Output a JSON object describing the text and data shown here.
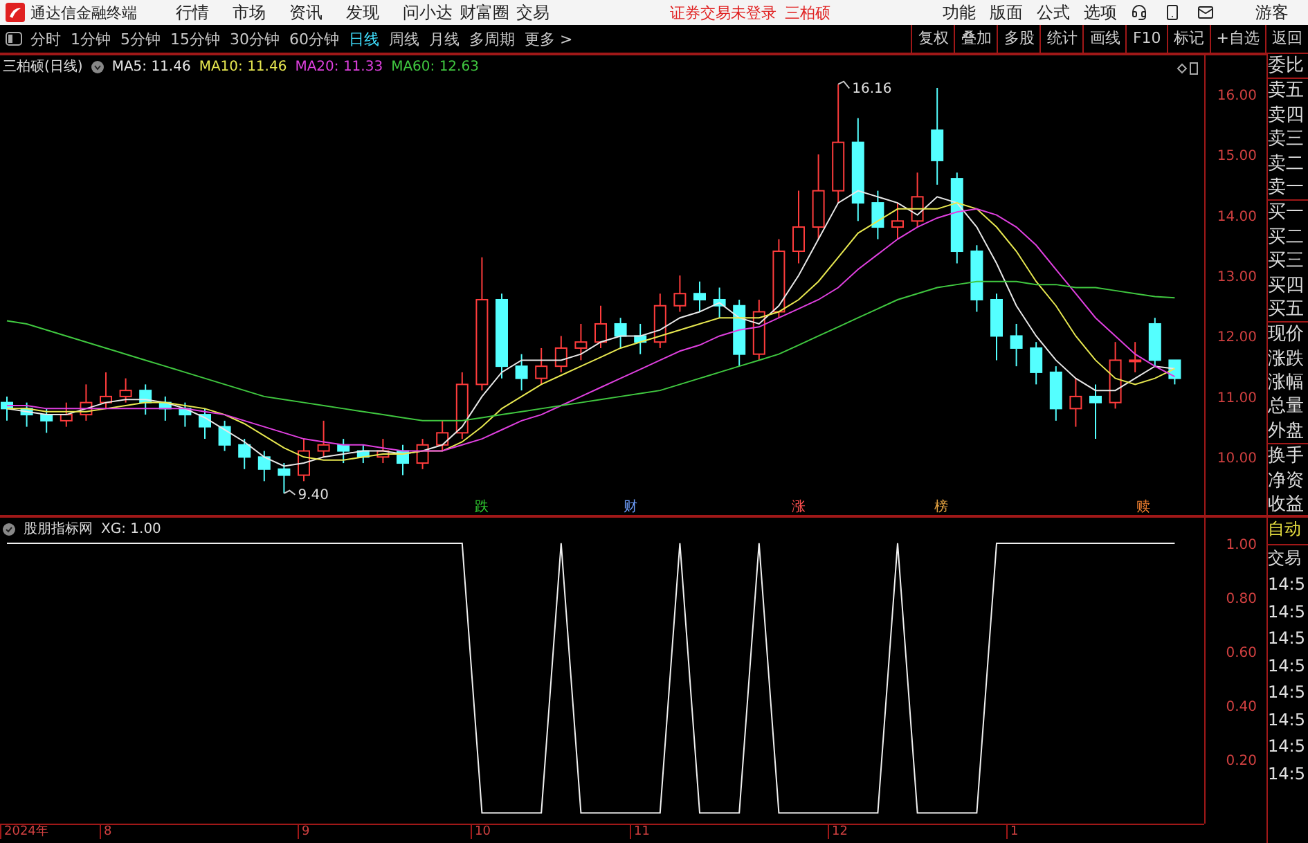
{
  "menu_bar": {
    "app_title": "通达信金融终端",
    "menus": [
      "行情",
      "市场",
      "资讯",
      "发现",
      "问小达",
      "财富圈",
      "交易"
    ],
    "login_status": "证券交易未登录",
    "stock_name": "三柏硕",
    "right_menus": [
      "功能",
      "版面",
      "公式",
      "选项"
    ],
    "user": "游客"
  },
  "toolbar": {
    "periods": [
      {
        "label": "分时",
        "selected": false
      },
      {
        "label": "1分钟",
        "selected": false
      },
      {
        "label": "5分钟",
        "selected": false
      },
      {
        "label": "15分钟",
        "selected": false
      },
      {
        "label": "30分钟",
        "selected": false
      },
      {
        "label": "60分钟",
        "selected": false
      },
      {
        "label": "日线",
        "selected": true
      },
      {
        "label": "周线",
        "selected": false
      },
      {
        "label": "月线",
        "selected": false
      },
      {
        "label": "多周期",
        "selected": false
      },
      {
        "label": "更多 >",
        "selected": false
      }
    ],
    "actions": [
      "复权",
      "叠加",
      "多股",
      "统计",
      "画线",
      "F10",
      "标记",
      "+自选",
      "返回"
    ]
  },
  "main_chart": {
    "title": "三柏硕(日线)",
    "indicators": [
      {
        "label": "MA5: 11.46",
        "color": "#e8e8e8"
      },
      {
        "label": "MA10: 11.46",
        "color": "#e8e850"
      },
      {
        "label": "MA20: 11.33",
        "color": "#e040e0"
      },
      {
        "label": "MA60: 12.63",
        "color": "#40c840"
      }
    ],
    "signals": [
      {
        "text": "跌",
        "color": "#30d030"
      },
      {
        "text": "财",
        "color": "#70a0ff"
      },
      {
        "text": "涨",
        "color": "#ff5050"
      },
      {
        "text": "榜",
        "color": "#e0a040"
      },
      {
        "text": "赎",
        "color": "#f08030"
      }
    ],
    "chart_data": {
      "type": "candlestick",
      "ohlc": [
        [
          10.9,
          11.0,
          10.6,
          10.8
        ],
        [
          10.8,
          10.9,
          10.5,
          10.7
        ],
        [
          10.7,
          10.8,
          10.4,
          10.6
        ],
        [
          10.6,
          10.9,
          10.5,
          10.7
        ],
        [
          10.7,
          11.2,
          10.6,
          10.9
        ],
        [
          10.9,
          11.4,
          10.8,
          11.0
        ],
        [
          11.0,
          11.3,
          10.9,
          11.1
        ],
        [
          11.1,
          11.2,
          10.7,
          10.9
        ],
        [
          10.9,
          11.0,
          10.6,
          10.8
        ],
        [
          10.8,
          10.9,
          10.5,
          10.7
        ],
        [
          10.7,
          10.8,
          10.3,
          10.5
        ],
        [
          10.5,
          10.6,
          10.1,
          10.2
        ],
        [
          10.2,
          10.3,
          9.8,
          10.0
        ],
        [
          10.0,
          10.1,
          9.6,
          9.8
        ],
        [
          9.8,
          9.9,
          9.4,
          9.7
        ],
        [
          9.7,
          10.3,
          9.6,
          10.1
        ],
        [
          10.1,
          10.6,
          10.0,
          10.2
        ],
        [
          10.2,
          10.3,
          9.9,
          10.1
        ],
        [
          10.1,
          10.2,
          9.9,
          10.0
        ],
        [
          10.0,
          10.3,
          9.9,
          10.1
        ],
        [
          10.1,
          10.2,
          9.7,
          9.9
        ],
        [
          9.9,
          10.3,
          9.8,
          10.2
        ],
        [
          10.2,
          10.6,
          10.1,
          10.4
        ],
        [
          10.4,
          11.4,
          10.3,
          11.2
        ],
        [
          11.2,
          13.3,
          11.1,
          12.6
        ],
        [
          12.6,
          12.7,
          11.3,
          11.5
        ],
        [
          11.5,
          11.7,
          11.1,
          11.3
        ],
        [
          11.3,
          11.8,
          11.2,
          11.5
        ],
        [
          11.5,
          12.0,
          11.4,
          11.8
        ],
        [
          11.8,
          12.2,
          11.6,
          11.9
        ],
        [
          11.9,
          12.5,
          11.8,
          12.2
        ],
        [
          12.2,
          12.3,
          11.8,
          12.0
        ],
        [
          12.0,
          12.2,
          11.7,
          11.9
        ],
        [
          11.9,
          12.7,
          11.8,
          12.5
        ],
        [
          12.5,
          13.0,
          12.4,
          12.7
        ],
        [
          12.7,
          12.9,
          12.4,
          12.6
        ],
        [
          12.6,
          12.8,
          12.3,
          12.5
        ],
        [
          12.5,
          12.6,
          11.5,
          11.7
        ],
        [
          11.7,
          12.6,
          11.6,
          12.4
        ],
        [
          12.4,
          13.6,
          12.3,
          13.4
        ],
        [
          13.4,
          14.4,
          13.2,
          13.8
        ],
        [
          13.8,
          15.0,
          13.6,
          14.4
        ],
        [
          14.4,
          16.16,
          14.2,
          15.2
        ],
        [
          15.2,
          15.6,
          13.9,
          14.2
        ],
        [
          14.2,
          14.4,
          13.6,
          13.8
        ],
        [
          13.8,
          14.2,
          13.6,
          13.9
        ],
        [
          13.9,
          14.7,
          13.8,
          14.3
        ],
        [
          15.4,
          16.1,
          14.5,
          14.9
        ],
        [
          14.6,
          14.7,
          13.2,
          13.4
        ],
        [
          13.4,
          13.5,
          12.4,
          12.6
        ],
        [
          12.6,
          12.7,
          11.6,
          12.0
        ],
        [
          12.0,
          12.2,
          11.5,
          11.8
        ],
        [
          11.8,
          11.9,
          11.2,
          11.4
        ],
        [
          11.4,
          11.5,
          10.6,
          10.8
        ],
        [
          10.8,
          11.3,
          10.5,
          11.0
        ],
        [
          11.0,
          11.2,
          10.3,
          10.9
        ],
        [
          10.9,
          11.9,
          10.8,
          11.6
        ],
        [
          11.6,
          11.9,
          11.4,
          11.6
        ],
        [
          12.2,
          12.3,
          11.5,
          11.6
        ],
        [
          11.6,
          11.6,
          11.2,
          11.3
        ]
      ],
      "ylim": [
        9.02,
        16.66
      ],
      "yticks": [
        {
          "value": 10,
          "label": "10.00"
        },
        {
          "value": 11,
          "label": "11.00"
        },
        {
          "value": 12,
          "label": "12.00"
        },
        {
          "value": 13,
          "label": "13.00"
        },
        {
          "value": 14,
          "label": "14.00"
        },
        {
          "value": 15,
          "label": "15.00"
        },
        {
          "value": 16,
          "label": "16.00"
        }
      ],
      "series": [
        {
          "type": "line",
          "color": "#e8e8e8",
          "values": [
            10.8,
            10.75,
            10.7,
            10.7,
            10.8,
            10.9,
            10.95,
            10.95,
            10.9,
            10.8,
            10.65,
            10.45,
            10.25,
            10.0,
            9.85,
            9.9,
            10.0,
            10.05,
            10.1,
            10.1,
            10.05,
            10.1,
            10.2,
            10.5,
            11.0,
            11.4,
            11.6,
            11.6,
            11.6,
            11.7,
            11.9,
            12.0,
            12.0,
            12.1,
            12.3,
            12.4,
            12.55,
            12.3,
            12.2,
            12.5,
            13.0,
            13.6,
            14.2,
            14.4,
            14.3,
            14.2,
            14.0,
            14.3,
            14.2,
            13.8,
            13.2,
            12.5,
            12.0,
            11.6,
            11.3,
            11.1,
            11.1,
            11.3,
            11.5,
            11.46
          ]
        },
        {
          "type": "line",
          "color": "#e8e850",
          "values": [
            10.8,
            10.8,
            10.75,
            10.75,
            10.75,
            10.8,
            10.85,
            10.9,
            10.9,
            10.85,
            10.8,
            10.7,
            10.55,
            10.35,
            10.15,
            10.0,
            9.95,
            9.95,
            10.0,
            10.05,
            10.05,
            10.1,
            10.1,
            10.25,
            10.5,
            10.8,
            11.0,
            11.2,
            11.35,
            11.5,
            11.65,
            11.8,
            11.9,
            12.0,
            12.1,
            12.2,
            12.3,
            12.3,
            12.3,
            12.4,
            12.6,
            12.9,
            13.3,
            13.7,
            13.9,
            14.1,
            14.1,
            14.1,
            14.2,
            14.1,
            13.8,
            13.4,
            12.9,
            12.5,
            12.0,
            11.6,
            11.3,
            11.2,
            11.3,
            11.46
          ]
        },
        {
          "type": "line",
          "color": "#e040e0",
          "values": [
            10.85,
            10.85,
            10.8,
            10.8,
            10.8,
            10.8,
            10.8,
            10.8,
            10.8,
            10.8,
            10.75,
            10.7,
            10.6,
            10.5,
            10.4,
            10.3,
            10.25,
            10.2,
            10.2,
            10.15,
            10.1,
            10.1,
            10.1,
            10.2,
            10.3,
            10.45,
            10.6,
            10.7,
            10.85,
            11.0,
            11.15,
            11.3,
            11.45,
            11.6,
            11.75,
            11.85,
            12.0,
            12.1,
            12.15,
            12.3,
            12.45,
            12.6,
            12.8,
            13.1,
            13.35,
            13.6,
            13.8,
            13.95,
            14.05,
            14.1,
            14.0,
            13.8,
            13.5,
            13.1,
            12.7,
            12.3,
            12.0,
            11.7,
            11.5,
            11.33
          ]
        },
        {
          "type": "line",
          "color": "#40c840",
          "values": [
            12.25,
            12.2,
            12.1,
            12.0,
            11.9,
            11.8,
            11.7,
            11.6,
            11.5,
            11.4,
            11.3,
            11.2,
            11.1,
            11.0,
            10.95,
            10.9,
            10.85,
            10.8,
            10.75,
            10.7,
            10.65,
            10.6,
            10.6,
            10.6,
            10.65,
            10.7,
            10.75,
            10.8,
            10.85,
            10.9,
            10.95,
            11.0,
            11.05,
            11.1,
            11.2,
            11.3,
            11.4,
            11.5,
            11.6,
            11.7,
            11.85,
            12.0,
            12.15,
            12.3,
            12.45,
            12.6,
            12.7,
            12.8,
            12.85,
            12.9,
            12.9,
            12.9,
            12.85,
            12.85,
            12.8,
            12.8,
            12.75,
            12.7,
            12.65,
            12.63
          ]
        }
      ],
      "annotations": [
        "16.16",
        "9.40"
      ]
    }
  },
  "indicator_chart": {
    "title": "股朋指标网",
    "reading": "XG: 1.00",
    "chart_data": {
      "type": "line",
      "ylim": [
        -0.04,
        1.1
      ],
      "yticks": [
        {
          "value": 0.2,
          "label": "0.20"
        },
        {
          "value": 0.4,
          "label": "0.40"
        },
        {
          "value": 0.6,
          "label": "0.60"
        },
        {
          "value": 0.8,
          "label": "0.80"
        },
        {
          "value": 1,
          "label": "1.00"
        }
      ],
      "series": [
        {
          "color": "#f0f0f0",
          "values": [
            1,
            1,
            1,
            1,
            1,
            1,
            1,
            1,
            1,
            1,
            1,
            1,
            1,
            1,
            1,
            1,
            1,
            1,
            1,
            1,
            1,
            1,
            1,
            1,
            0,
            0,
            0,
            0,
            1,
            0,
            0,
            0,
            0,
            0,
            1,
            0,
            0,
            0,
            1,
            0,
            0,
            0,
            0,
            0,
            0,
            1,
            0,
            0,
            0,
            0,
            1,
            1,
            1,
            1,
            1,
            1,
            1,
            1,
            1,
            1
          ]
        }
      ]
    }
  },
  "date_axis": [
    "2024年",
    "8",
    "9",
    "10",
    "11",
    "12",
    "1"
  ],
  "quote_panel": {
    "groups": [
      [
        "委比"
      ],
      [
        "卖五",
        "卖四",
        "卖三",
        "卖二",
        "卖一"
      ],
      [
        "买一",
        "买二",
        "买三",
        "买四",
        "买五"
      ],
      [
        "现价",
        "涨跌",
        "涨幅",
        "总量",
        "外盘"
      ],
      [
        "换手",
        "净资",
        "收益"
      ]
    ]
  },
  "trade_panel": [
    {
      "kind": "mode",
      "text": "自动"
    },
    {
      "kind": "label",
      "text": "交易"
    },
    {
      "kind": "time",
      "text": "14:5"
    },
    {
      "kind": "time",
      "text": "14:5"
    },
    {
      "kind": "time",
      "text": "14:5"
    },
    {
      "kind": "time",
      "text": "14:5"
    },
    {
      "kind": "time",
      "text": "14:5"
    },
    {
      "kind": "time",
      "text": "14:5"
    },
    {
      "kind": "time",
      "text": "14:5"
    },
    {
      "kind": "time",
      "text": "14:5"
    }
  ]
}
